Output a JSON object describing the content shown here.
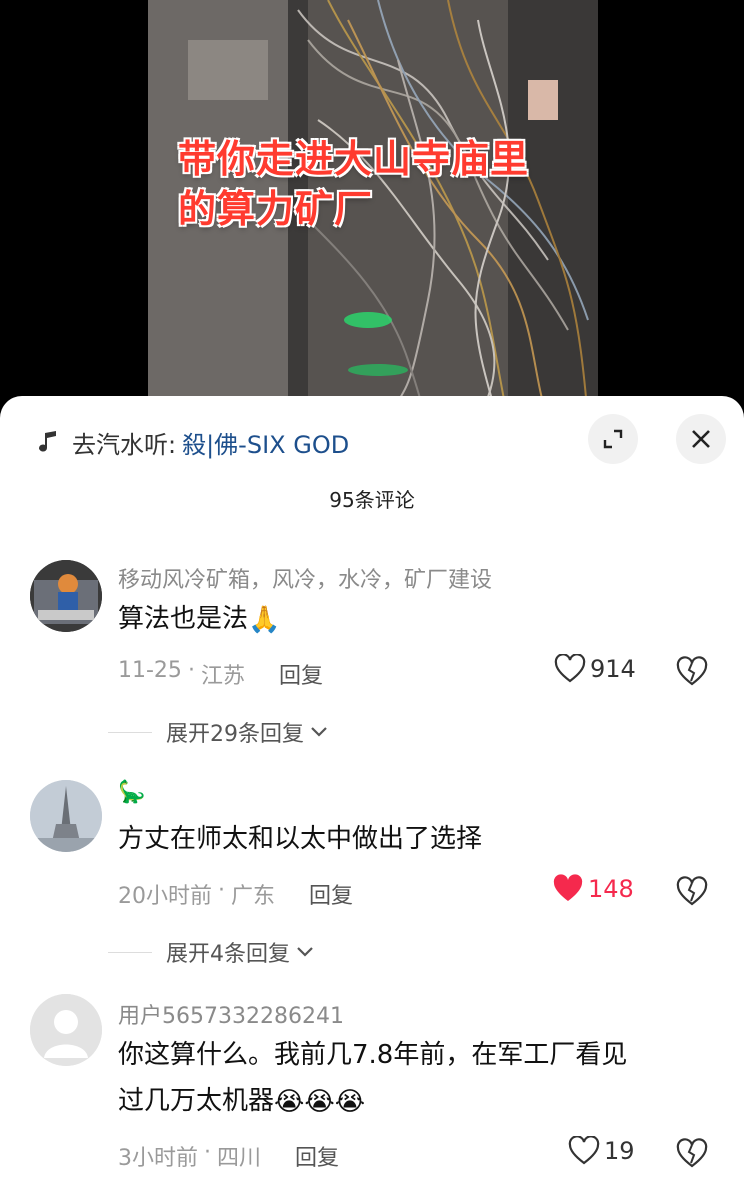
{
  "video": {
    "overlay_line1": "带你走进大山寺庙里",
    "overlay_line2": "的算力矿厂"
  },
  "music": {
    "prefix": "去汽水听:",
    "song": "殺|佛-SIX GOD"
  },
  "comments_count": "95条评论",
  "comments": [
    {
      "username": "移动风冷矿箱，风冷，水冷，矿厂建设",
      "text": "算法也是法",
      "emoji": "🙏",
      "date": "11-25",
      "location": "江苏",
      "reply_label": "回复",
      "likes": "914",
      "liked": false,
      "expand_label": "展开29条回复"
    },
    {
      "username": "🦕",
      "text": "方丈在师太和以太中做出了选择",
      "date": "20小时前",
      "location": "广东",
      "reply_label": "回复",
      "likes": "148",
      "liked": true,
      "expand_label": "展开4条回复"
    },
    {
      "username": "用户5657332286241",
      "text_line1": "你这算什么。我前几7.8年前，在军工厂看见",
      "text_line2": "过几万太机器",
      "emoji": "😭😭😭",
      "date": "3小时前",
      "location": "四川",
      "reply_label": "回复",
      "likes": "19",
      "liked": false
    }
  ],
  "colors": {
    "overlay_text": "#ff3b2f",
    "liked_heart": "#f5294d",
    "song_link": "#1d4f8c"
  },
  "icons": [
    "music-note-icon",
    "expand-icon",
    "close-icon",
    "heart-icon",
    "broken-heart-icon",
    "chevron-down-icon",
    "dinosaur-icon"
  ]
}
